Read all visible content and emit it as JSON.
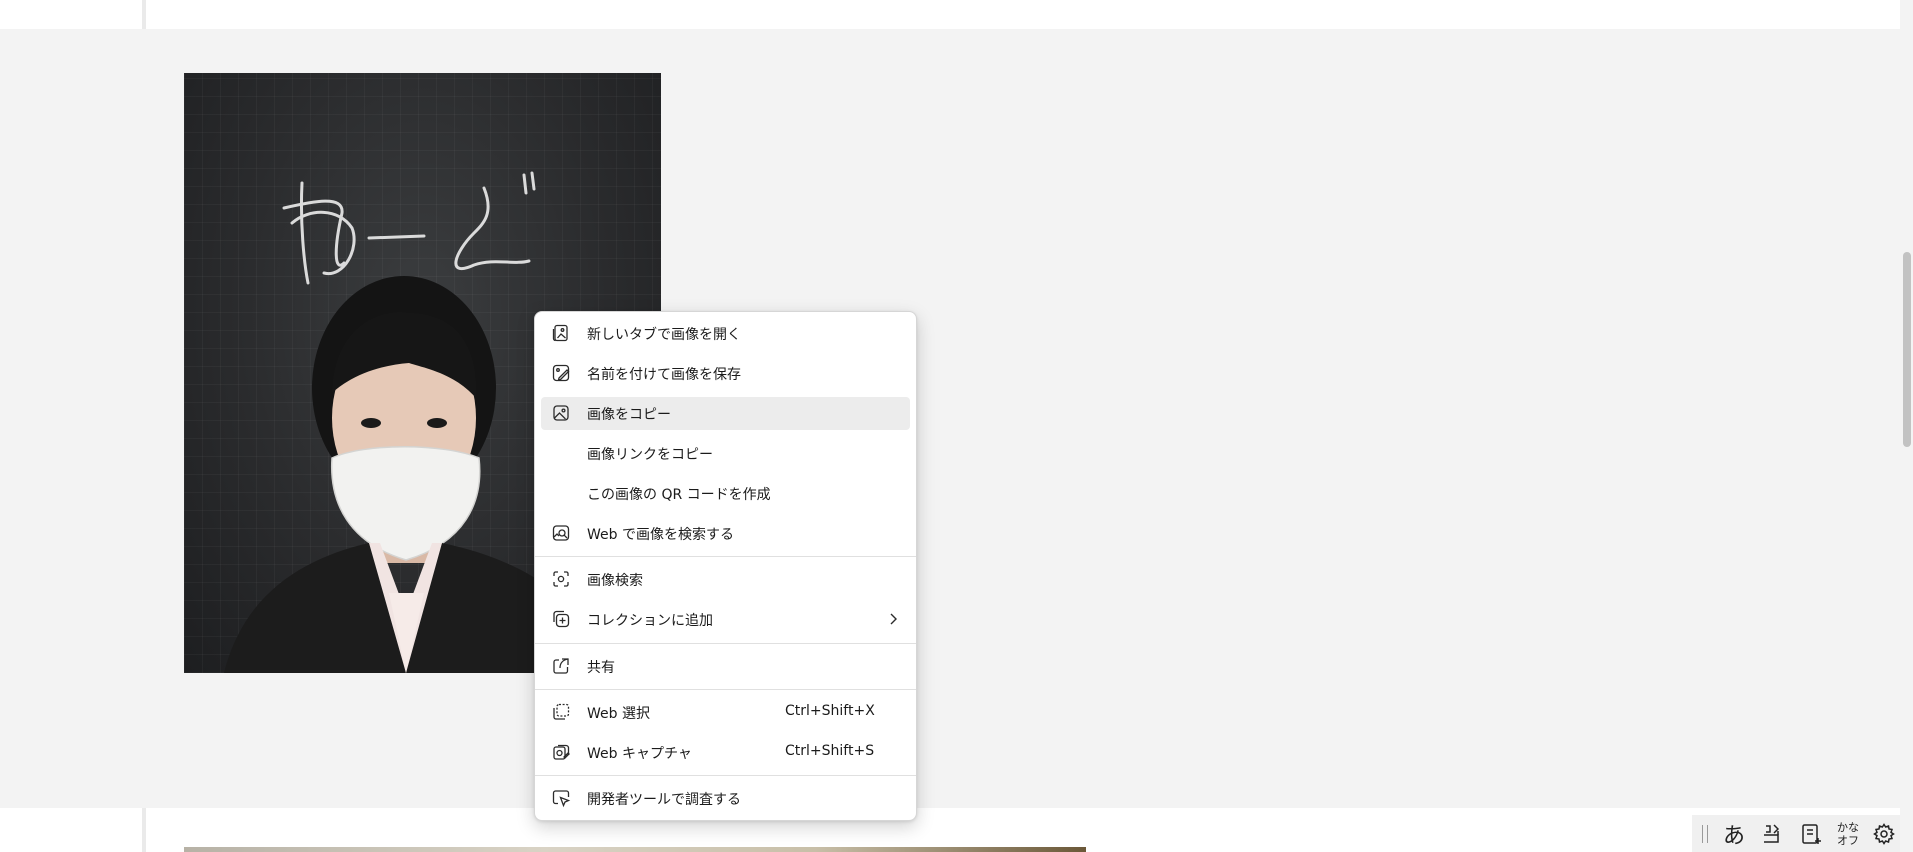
{
  "photo": {
    "chalk_text": "わーど",
    "icon": "photo-of-person"
  },
  "context_menu": {
    "items": [
      {
        "label": "新しいタブで画像を開く",
        "icon": "open-image-new-tab-icon"
      },
      {
        "label": "名前を付けて画像を保存",
        "icon": "save-image-icon"
      },
      {
        "label": "画像をコピー",
        "icon": "copy-image-icon",
        "highlighted": true
      },
      {
        "label": "画像リンクをコピー",
        "icon": ""
      },
      {
        "label": "この画像の QR コードを作成",
        "icon": ""
      },
      {
        "label": "Web で画像を検索する",
        "icon": "search-image-web-icon"
      },
      {
        "label": "画像検索",
        "icon": "visual-search-icon"
      },
      {
        "label": "コレクションに追加",
        "icon": "add-collection-icon",
        "submenu": true
      },
      {
        "label": "共有",
        "icon": "share-icon"
      },
      {
        "label": "Web 選択",
        "icon": "web-select-icon",
        "shortcut": "Ctrl+Shift+X"
      },
      {
        "label": "Web キャプチャ",
        "icon": "web-capture-icon",
        "shortcut": "Ctrl+Shift+S"
      },
      {
        "label": "開発者ツールで調査する",
        "icon": "devtools-inspect-icon"
      }
    ]
  },
  "ime_toolbar": {
    "input_mode": "あ",
    "kana_line1": "かな",
    "kana_line2": "オフ"
  },
  "colors": {
    "page_bg": "#f3f3f3",
    "menu_bg": "#ffffff",
    "menu_hover": "#ececec"
  }
}
